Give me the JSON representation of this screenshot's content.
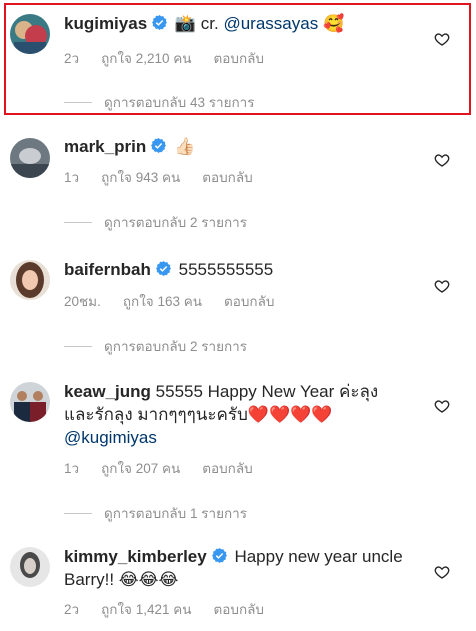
{
  "comments": [
    {
      "username": "kugimiyas",
      "verified": true,
      "text_icon": "📸",
      "text": " cr. ",
      "mention": "@urassayas",
      "emoji": "🥰",
      "time": "2ว",
      "likes": "ถูกใจ 2,210 คน",
      "reply_label": "ตอบกลับ",
      "view_replies": "ดูการตอบกลับ 43 รายการ"
    },
    {
      "username": "mark_prin",
      "verified": true,
      "emoji": "👍🏻",
      "time": "1ว",
      "likes": "ถูกใจ 943 คน",
      "reply_label": "ตอบกลับ",
      "view_replies": "ดูการตอบกลับ 2 รายการ"
    },
    {
      "username": "baifernbah",
      "verified": true,
      "text": "5555555555",
      "time": "20ชม.",
      "likes": "ถูกใจ 163 คน",
      "reply_label": "ตอบกลับ",
      "view_replies": "ดูการตอบกลับ 2 รายการ"
    },
    {
      "username": "keaw_jung",
      "verified": false,
      "text": "55555 Happy New Year ค่ะลุง และรักลุง มากๆๆๆนะครับ",
      "emoji": "❤️❤️❤️❤️",
      "mention": "@kugimiyas",
      "time": "1ว",
      "likes": "ถูกใจ 207 คน",
      "reply_label": "ตอบกลับ",
      "view_replies": "ดูการตอบกลับ 1 รายการ"
    },
    {
      "username": "kimmy_kimberley",
      "verified": true,
      "text": "Happy new year uncle Barry!!",
      "emoji": "😂😂😂",
      "time": "2ว",
      "likes": "ถูกใจ 1,421 คน",
      "reply_label": "ตอบกลับ"
    }
  ],
  "colors": {
    "highlight_border": "#e0141e",
    "verified_badge": "#3897f0",
    "meta_text": "#8e8e8e",
    "mention": "#00376b"
  },
  "icons": {
    "verified": "verified-badge-icon",
    "like": "heart-outline-icon"
  }
}
